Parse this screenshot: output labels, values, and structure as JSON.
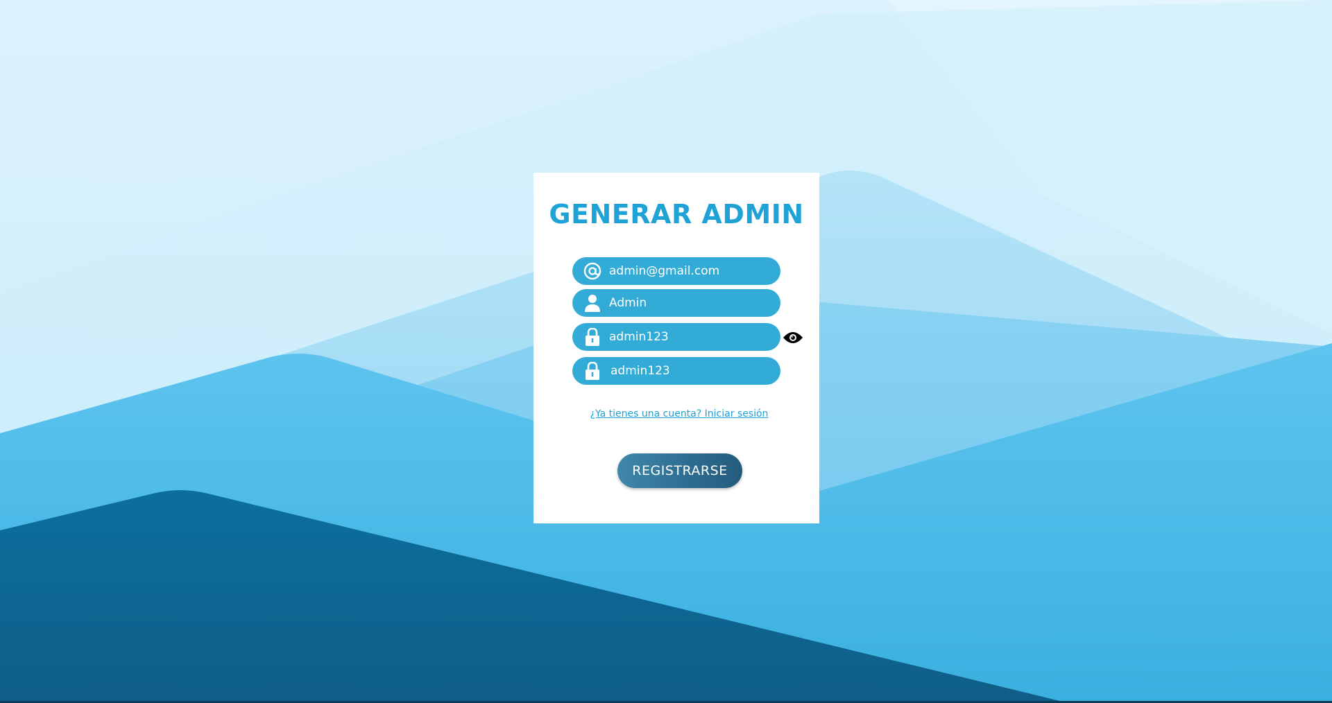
{
  "form": {
    "title": "GENERAR ADMIN",
    "email": {
      "value": "admin@gmail.com",
      "icon": "at-icon"
    },
    "username": {
      "value": "Admin",
      "icon": "user-icon"
    },
    "password": {
      "value": "admin123",
      "icon": "lock-icon"
    },
    "confirm_password": {
      "value": "admin123",
      "icon": "lock-icon"
    },
    "toggle_visibility_icon": "eye-icon",
    "login_link": "¿Ya tienes una cuenta? Iniciar sesión",
    "submit_label": "REGISTRARSE"
  },
  "colors": {
    "accent": "#1fa3d6",
    "field_bg": "#33abd7",
    "button_dark": "#245b7c",
    "card_bg": "#ffffff"
  }
}
